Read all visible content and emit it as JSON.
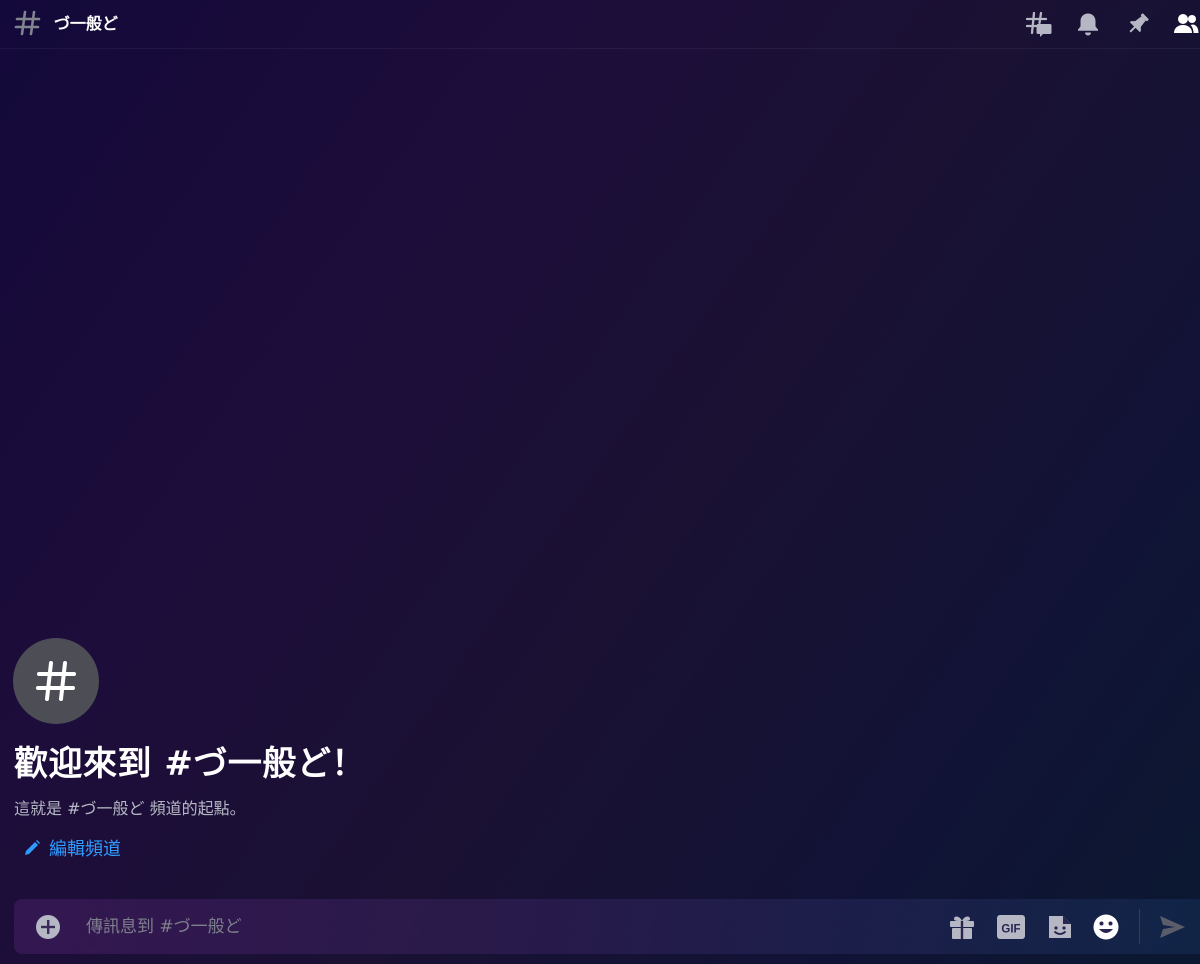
{
  "header": {
    "channel_name": "づ一般ど",
    "icons": [
      "threads-icon",
      "bell-icon",
      "pin-icon",
      "members-icon"
    ]
  },
  "welcome": {
    "title": "歡迎來到 #づ一般ど！",
    "subtitle": "這就是 #づ一般ど 頻道的起點。",
    "edit_label": "編輯頻道"
  },
  "composer": {
    "placeholder": "傳訊息到 #づ一般ど",
    "value": "",
    "gif_label": "GIF",
    "icons": [
      "plus-circle-icon",
      "gift-icon",
      "gif-icon",
      "sticker-icon",
      "emoji-icon",
      "send-icon"
    ]
  },
  "colors": {
    "accent_link": "#2f9bff",
    "avatar_bg": "#4c4d55",
    "icon_gray": "#b5b8c4",
    "subtitle_text": "#b5b8c4"
  }
}
